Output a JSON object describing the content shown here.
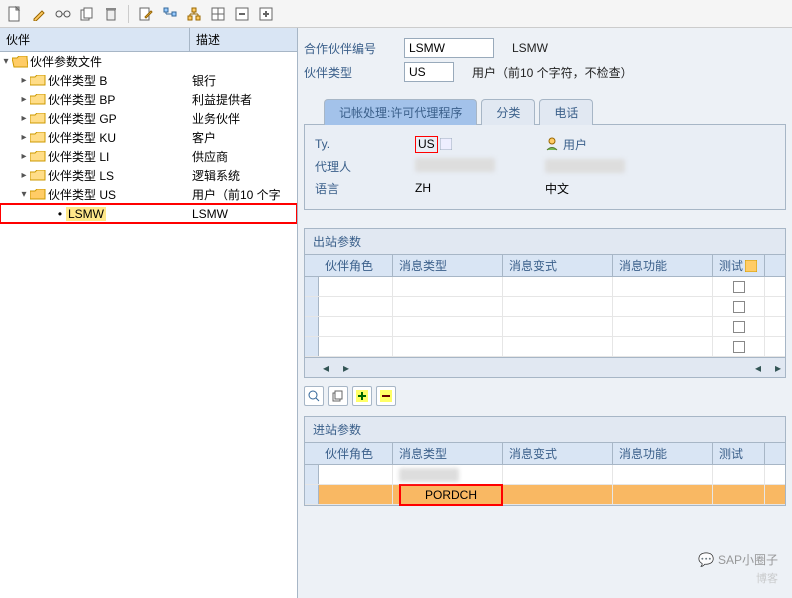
{
  "toolbar_icons": [
    "new-page-icon",
    "pencil-icon",
    "glasses-icon",
    "copy-icon",
    "trash-icon",
    "edit-doc-icon",
    "tree-icon",
    "hierarchy-icon",
    "grid-icon",
    "collapse-icon",
    "expand-icon"
  ],
  "tree": {
    "header_col1": "伙伴",
    "header_col2": "描述",
    "root": "伙伴参数文件",
    "nodes": [
      {
        "label": "伙伴类型 B",
        "desc": "银行"
      },
      {
        "label": "伙伴类型 BP",
        "desc": "利益提供者"
      },
      {
        "label": "伙伴类型 GP",
        "desc": "业务伙伴"
      },
      {
        "label": "伙伴类型 KU",
        "desc": "客户"
      },
      {
        "label": "伙伴类型 LI",
        "desc": "供应商"
      },
      {
        "label": "伙伴类型 LS",
        "desc": "逻辑系统"
      },
      {
        "label": "伙伴类型 US",
        "desc": "用户（前10 个字"
      }
    ],
    "leaf": {
      "label": "LSMW",
      "desc": "LSMW"
    }
  },
  "form": {
    "partner_no_lbl": "合作伙伴编号",
    "partner_no_val": "LSMW",
    "partner_no_desc": "LSMW",
    "partner_type_lbl": "伙伴类型",
    "partner_type_val": "US",
    "partner_type_desc": "用户（前10 个字符，不检查）"
  },
  "tabs": {
    "t1": "记帐处理:许可代理程序",
    "t2": "分类",
    "t3": "电话"
  },
  "tab_content": {
    "ty_lbl": "Ty.",
    "ty_val": "US",
    "user_lbl": "用户",
    "agent_lbl": "代理人",
    "lang_lbl": "语言",
    "lang_val": "ZH",
    "lang_desc": "中文"
  },
  "outbound": {
    "title": "出站参数",
    "cols": {
      "c1": "伙伴角色",
      "c2": "消息类型",
      "c3": "消息变式",
      "c4": "消息功能",
      "c5": "测试"
    }
  },
  "inbound": {
    "title": "进站参数",
    "cols": {
      "c1": "伙伴角色",
      "c2": "消息类型",
      "c3": "消息变式",
      "c4": "消息功能",
      "c5": "测试"
    },
    "row1_msgtype": "PORDCH"
  },
  "watermark": "SAP小圈子",
  "watermark2": "博客"
}
